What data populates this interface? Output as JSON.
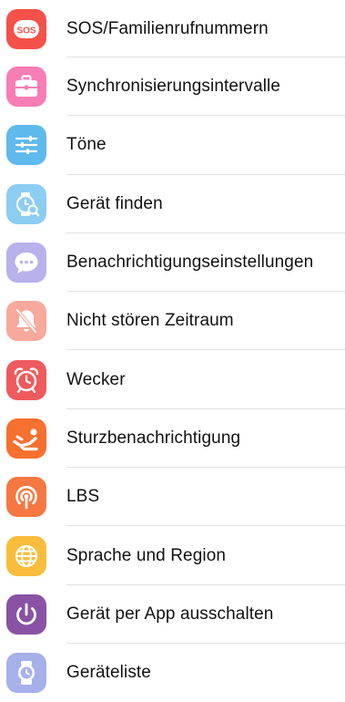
{
  "settings": {
    "items": [
      {
        "label": "SOS/Familienrufnummern",
        "icon": "sos-icon",
        "color": "#f5514b",
        "sos_text": "SOS"
      },
      {
        "label": "Synchronisierungsintervalle",
        "icon": "briefcase-icon",
        "color": "#f77eb5"
      },
      {
        "label": "Töne",
        "icon": "sliders-icon",
        "color": "#5fb9ec"
      },
      {
        "label": "Gerät finden",
        "icon": "find-watch-icon",
        "color": "#8ccdf2"
      },
      {
        "label": "Benachrichtigungseinstellungen",
        "icon": "chat-bubble-icon",
        "color": "#b9b1ec"
      },
      {
        "label": "Nicht stören Zeitraum",
        "icon": "bell-off-icon",
        "color": "#f7a99c"
      },
      {
        "label": "Wecker",
        "icon": "alarm-clock-icon",
        "color": "#ee5a5e"
      },
      {
        "label": "Sturzbenachrichtigung",
        "icon": "fall-person-icon",
        "color": "#f6702f"
      },
      {
        "label": "LBS",
        "icon": "location-signal-icon",
        "color": "#f57842"
      },
      {
        "label": "Sprache und Region",
        "icon": "globe-icon",
        "color": "#f8bd3c"
      },
      {
        "label": "Gerät per App ausschalten",
        "icon": "power-icon",
        "color": "#8a52a4"
      },
      {
        "label": "Geräteliste",
        "icon": "watch-icon",
        "color": "#a6b0e9"
      }
    ]
  }
}
